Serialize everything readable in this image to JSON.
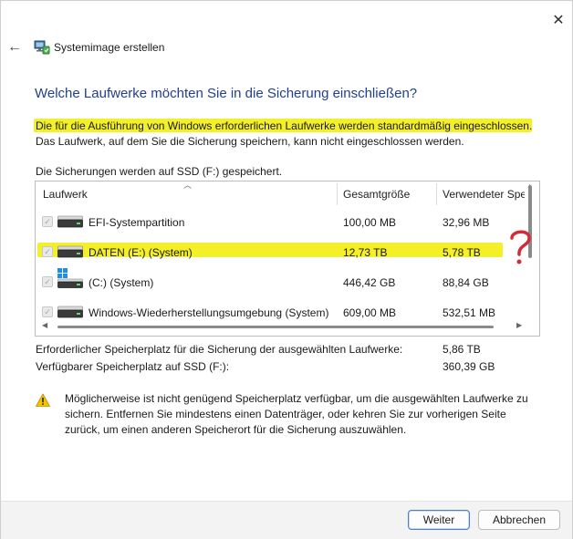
{
  "window": {
    "title": "Systemimage erstellen",
    "close_glyph": "✕",
    "back_glyph": "←"
  },
  "heading": "Welche Laufwerke möchten Sie in die Sicherung einschließen?",
  "intro": {
    "line1": "Die für die Ausführung von Windows erforderlichen Laufwerke werden standardmäßig eingeschlossen.",
    "line2": "Das Laufwerk, auf dem Sie die Sicherung speichern, kann nicht eingeschlossen werden."
  },
  "save_info": "Die Sicherungen werden auf SSD (F:) gespeichert.",
  "table": {
    "columns": [
      "Laufwerk",
      "Gesamtgröße",
      "Verwendeter Spe"
    ],
    "rows": [
      {
        "name": "EFI-Systempartition",
        "total": "100,00 MB",
        "used": "32,96 MB",
        "checked": true,
        "icon": "disk-drive-icon"
      },
      {
        "name": "DATEN (E:) (System)",
        "total": "12,73 TB",
        "used": "5,78 TB",
        "checked": true,
        "icon": "disk-drive-icon"
      },
      {
        "name": "(C:) (System)",
        "total": "446,42 GB",
        "used": "88,84 GB",
        "checked": true,
        "icon": "windows-drive-icon"
      },
      {
        "name": "Windows-Wiederherstellungsumgebung (System)",
        "total": "609,00 MB",
        "used": "532,51 MB",
        "checked": true,
        "icon": "disk-drive-icon"
      }
    ]
  },
  "summary": {
    "required_label": "Erforderlicher Speicherplatz für die Sicherung der ausgewählten Laufwerke:",
    "required_value": "5,86 TB",
    "available_label": "Verfügbarer Speicherplatz auf SSD (F:):",
    "available_value": "360,39 GB"
  },
  "warning": {
    "icon": "warning-icon",
    "text": "Möglicherweise ist nicht genügend Speicherplatz verfügbar, um die ausgewählten Laufwerke zu sichern. Entfernen Sie mindestens einen Datenträger, oder kehren Sie zur vorherigen Seite zurück, um einen anderen Speicherort für die Sicherung auszuwählen."
  },
  "buttons": {
    "next": "Weiter",
    "cancel": "Abbrechen"
  },
  "colors": {
    "heading": "#1f3f8f",
    "highlight": "#f3ef29",
    "annotation": "#d42a3a",
    "primary_border": "#4a7fd0"
  }
}
